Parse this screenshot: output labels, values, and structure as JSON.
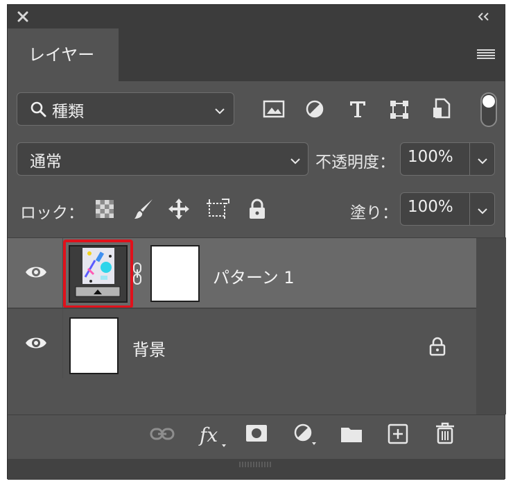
{
  "panel": {
    "tab_label": "レイヤー"
  },
  "filter": {
    "label": "種類"
  },
  "blend": {
    "mode": "通常",
    "opacity_label": "不透明度：",
    "opacity_value": "100%"
  },
  "lock": {
    "label": "ロック：",
    "fill_label": "塗り：",
    "fill_value": "100%"
  },
  "layers": [
    {
      "name": "パターン 1",
      "selected": true
    },
    {
      "name": "背景",
      "locked": true
    }
  ],
  "colors": {
    "panel_bg": "#535353",
    "header_bg": "#3c3c3c",
    "selected_row": "#696969",
    "highlight_red": "#e0111b",
    "field_bg": "#434343"
  },
  "icons": {
    "close": "close-icon",
    "collapse": "double-chevron-left-icon",
    "menu": "hamburger-menu-icon",
    "filter": [
      "image-filter-icon",
      "adjustment-filter-icon",
      "type-filter-icon",
      "shape-filter-icon",
      "smart-object-filter-icon"
    ],
    "lock": [
      "lock-transparent-pixels-icon",
      "lock-image-pixels-icon",
      "lock-position-icon",
      "lock-artboard-icon",
      "lock-all-icon"
    ],
    "bottom": [
      "link-layers-icon",
      "fx-icon",
      "add-mask-icon",
      "new-adjustment-icon",
      "new-group-icon",
      "new-layer-icon",
      "trash-icon"
    ]
  }
}
